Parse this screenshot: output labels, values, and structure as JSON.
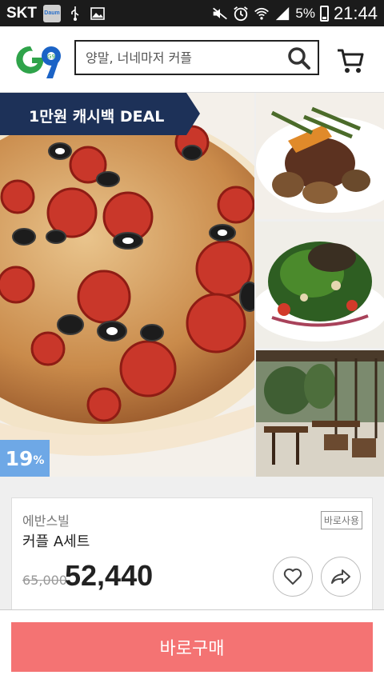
{
  "status_bar": {
    "carrier": "SKT",
    "battery": "5%",
    "time": "21:44",
    "daum_label": "Daum"
  },
  "header": {
    "logo": "G9",
    "search_placeholder": "양말, 너네마저 커플"
  },
  "deal": {
    "banner": "1만원 캐시백 DEAL",
    "discount_value": "19",
    "discount_unit": "%"
  },
  "product": {
    "brand": "에반스빌",
    "name": "커플 A세트",
    "badge": "바로사용",
    "old_price": "65,000",
    "price": "52,440"
  },
  "buy_button": "바로구매",
  "colors": {
    "banner_bg": "#1d3158",
    "discount_bg": "#6ea8e6",
    "buy_bg": "#f47373",
    "logo_green": "#2fa34a",
    "logo_blue": "#1b63c6"
  },
  "icons": [
    "usb-icon",
    "image-icon",
    "mute-icon",
    "alarm-icon",
    "wifi-icon",
    "signal-icon",
    "battery-icon",
    "search-icon",
    "cart-icon",
    "heart-icon",
    "share-icon"
  ]
}
